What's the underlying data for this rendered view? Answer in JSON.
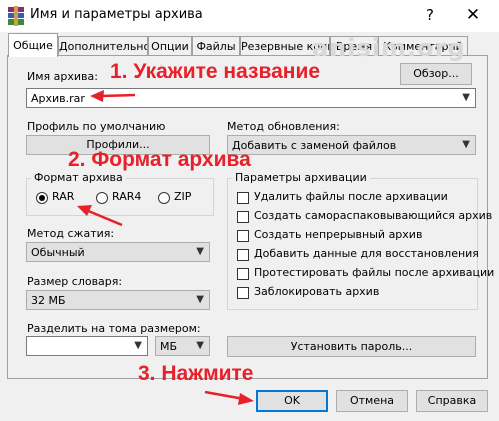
{
  "window": {
    "title": "Имя и параметры архива",
    "help": "?",
    "close": "✕"
  },
  "tabs": [
    {
      "label": "Общие"
    },
    {
      "label": "Дополнительно"
    },
    {
      "label": "Опции"
    },
    {
      "label": "Файлы"
    },
    {
      "label": "Резервные копии"
    },
    {
      "label": "Время"
    },
    {
      "label": "Комментарий"
    }
  ],
  "watermark": "anisim.org",
  "archive_name": {
    "label": "Имя архива:",
    "value": "Архив.rar",
    "browse": "Обзор..."
  },
  "profile": {
    "label": "Профиль по умолчанию",
    "button": "Профили..."
  },
  "update_method": {
    "label": "Метод обновления:",
    "value": "Добавить с заменой файлов"
  },
  "format": {
    "title": "Формат архива",
    "options": [
      {
        "label": "RAR",
        "selected": true
      },
      {
        "label": "RAR4",
        "selected": false
      },
      {
        "label": "ZIP",
        "selected": false
      }
    ]
  },
  "options": {
    "title": "Параметры архивации",
    "items": [
      "Удалить файлы после архивации",
      "Создать самораспаковывающийся архив",
      "Создать непрерывный архив",
      "Добавить данные для восстановления",
      "Протестировать файлы после архивации",
      "Заблокировать архив"
    ]
  },
  "compression": {
    "label": "Метод сжатия:",
    "value": "Обычный"
  },
  "dictionary": {
    "label": "Размер словаря:",
    "value": "32 МБ"
  },
  "split": {
    "label": "Разделить на тома размером:",
    "value": "",
    "unit": "МБ"
  },
  "password_button": "Установить пароль...",
  "buttons": {
    "ok": "OK",
    "cancel": "Отмена",
    "help": "Справка"
  },
  "annotations": {
    "step1": "1. Укажите название",
    "step2": "2. Формат архива",
    "step3": "3. Нажмите",
    "color": "#e8202a"
  }
}
